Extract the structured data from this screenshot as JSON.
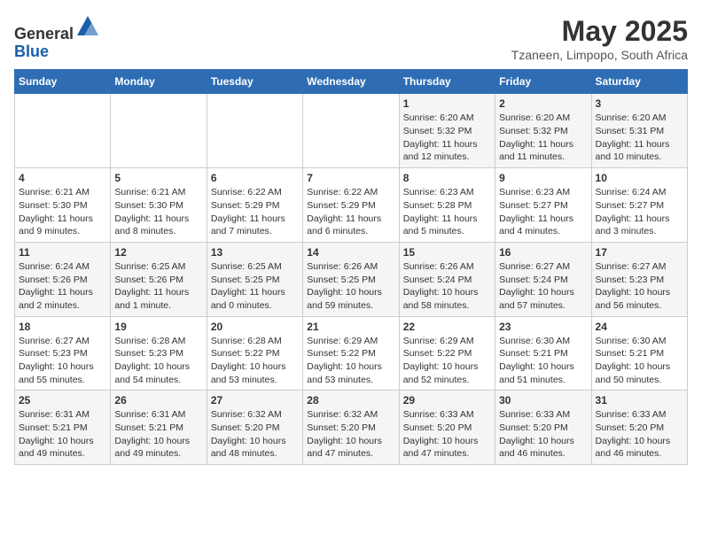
{
  "header": {
    "logo_line1": "General",
    "logo_line2": "Blue",
    "month": "May 2025",
    "location": "Tzaneen, Limpopo, South Africa"
  },
  "weekdays": [
    "Sunday",
    "Monday",
    "Tuesday",
    "Wednesday",
    "Thursday",
    "Friday",
    "Saturday"
  ],
  "weeks": [
    [
      {
        "day": "",
        "info": ""
      },
      {
        "day": "",
        "info": ""
      },
      {
        "day": "",
        "info": ""
      },
      {
        "day": "",
        "info": ""
      },
      {
        "day": "1",
        "info": "Sunrise: 6:20 AM\nSunset: 5:32 PM\nDaylight: 11 hours\nand 12 minutes."
      },
      {
        "day": "2",
        "info": "Sunrise: 6:20 AM\nSunset: 5:32 PM\nDaylight: 11 hours\nand 11 minutes."
      },
      {
        "day": "3",
        "info": "Sunrise: 6:20 AM\nSunset: 5:31 PM\nDaylight: 11 hours\nand 10 minutes."
      }
    ],
    [
      {
        "day": "4",
        "info": "Sunrise: 6:21 AM\nSunset: 5:30 PM\nDaylight: 11 hours\nand 9 minutes."
      },
      {
        "day": "5",
        "info": "Sunrise: 6:21 AM\nSunset: 5:30 PM\nDaylight: 11 hours\nand 8 minutes."
      },
      {
        "day": "6",
        "info": "Sunrise: 6:22 AM\nSunset: 5:29 PM\nDaylight: 11 hours\nand 7 minutes."
      },
      {
        "day": "7",
        "info": "Sunrise: 6:22 AM\nSunset: 5:29 PM\nDaylight: 11 hours\nand 6 minutes."
      },
      {
        "day": "8",
        "info": "Sunrise: 6:23 AM\nSunset: 5:28 PM\nDaylight: 11 hours\nand 5 minutes."
      },
      {
        "day": "9",
        "info": "Sunrise: 6:23 AM\nSunset: 5:27 PM\nDaylight: 11 hours\nand 4 minutes."
      },
      {
        "day": "10",
        "info": "Sunrise: 6:24 AM\nSunset: 5:27 PM\nDaylight: 11 hours\nand 3 minutes."
      }
    ],
    [
      {
        "day": "11",
        "info": "Sunrise: 6:24 AM\nSunset: 5:26 PM\nDaylight: 11 hours\nand 2 minutes."
      },
      {
        "day": "12",
        "info": "Sunrise: 6:25 AM\nSunset: 5:26 PM\nDaylight: 11 hours\nand 1 minute."
      },
      {
        "day": "13",
        "info": "Sunrise: 6:25 AM\nSunset: 5:25 PM\nDaylight: 11 hours\nand 0 minutes."
      },
      {
        "day": "14",
        "info": "Sunrise: 6:26 AM\nSunset: 5:25 PM\nDaylight: 10 hours\nand 59 minutes."
      },
      {
        "day": "15",
        "info": "Sunrise: 6:26 AM\nSunset: 5:24 PM\nDaylight: 10 hours\nand 58 minutes."
      },
      {
        "day": "16",
        "info": "Sunrise: 6:27 AM\nSunset: 5:24 PM\nDaylight: 10 hours\nand 57 minutes."
      },
      {
        "day": "17",
        "info": "Sunrise: 6:27 AM\nSunset: 5:23 PM\nDaylight: 10 hours\nand 56 minutes."
      }
    ],
    [
      {
        "day": "18",
        "info": "Sunrise: 6:27 AM\nSunset: 5:23 PM\nDaylight: 10 hours\nand 55 minutes."
      },
      {
        "day": "19",
        "info": "Sunrise: 6:28 AM\nSunset: 5:23 PM\nDaylight: 10 hours\nand 54 minutes."
      },
      {
        "day": "20",
        "info": "Sunrise: 6:28 AM\nSunset: 5:22 PM\nDaylight: 10 hours\nand 53 minutes."
      },
      {
        "day": "21",
        "info": "Sunrise: 6:29 AM\nSunset: 5:22 PM\nDaylight: 10 hours\nand 53 minutes."
      },
      {
        "day": "22",
        "info": "Sunrise: 6:29 AM\nSunset: 5:22 PM\nDaylight: 10 hours\nand 52 minutes."
      },
      {
        "day": "23",
        "info": "Sunrise: 6:30 AM\nSunset: 5:21 PM\nDaylight: 10 hours\nand 51 minutes."
      },
      {
        "day": "24",
        "info": "Sunrise: 6:30 AM\nSunset: 5:21 PM\nDaylight: 10 hours\nand 50 minutes."
      }
    ],
    [
      {
        "day": "25",
        "info": "Sunrise: 6:31 AM\nSunset: 5:21 PM\nDaylight: 10 hours\nand 49 minutes."
      },
      {
        "day": "26",
        "info": "Sunrise: 6:31 AM\nSunset: 5:21 PM\nDaylight: 10 hours\nand 49 minutes."
      },
      {
        "day": "27",
        "info": "Sunrise: 6:32 AM\nSunset: 5:20 PM\nDaylight: 10 hours\nand 48 minutes."
      },
      {
        "day": "28",
        "info": "Sunrise: 6:32 AM\nSunset: 5:20 PM\nDaylight: 10 hours\nand 47 minutes."
      },
      {
        "day": "29",
        "info": "Sunrise: 6:33 AM\nSunset: 5:20 PM\nDaylight: 10 hours\nand 47 minutes."
      },
      {
        "day": "30",
        "info": "Sunrise: 6:33 AM\nSunset: 5:20 PM\nDaylight: 10 hours\nand 46 minutes."
      },
      {
        "day": "31",
        "info": "Sunrise: 6:33 AM\nSunset: 5:20 PM\nDaylight: 10 hours\nand 46 minutes."
      }
    ]
  ]
}
